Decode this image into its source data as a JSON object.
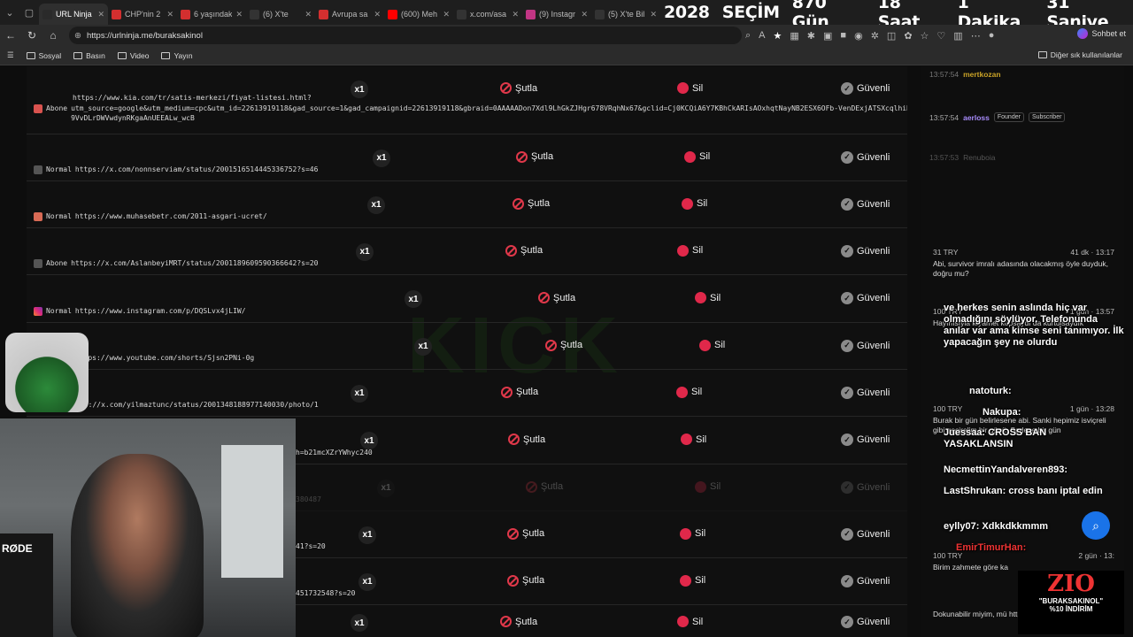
{
  "browser": {
    "tabs": [
      {
        "title": "URL Ninja |",
        "icon": "kick-icon",
        "color": "#2a2a2a",
        "active": true
      },
      {
        "title": "CHP'nin 2",
        "icon": "news-icon",
        "color": "#d32f2f"
      },
      {
        "title": "6 yaşındaki",
        "icon": "news-icon",
        "color": "#d32f2f"
      },
      {
        "title": "(6) X'te",
        "icon": "x-icon",
        "color": "#333"
      },
      {
        "title": "Avrupa sa",
        "icon": "news-icon",
        "color": "#d32f2f"
      },
      {
        "title": "(600) Meh",
        "icon": "youtube-icon",
        "color": "#ff0000"
      },
      {
        "title": "x.com/asa",
        "icon": "x-icon",
        "color": "#333"
      },
      {
        "title": "(9) Instagr",
        "icon": "instagram-icon",
        "color": "#c13584"
      },
      {
        "title": "(5) X'te Bil",
        "icon": "x-icon",
        "color": "#333"
      }
    ],
    "countdown": {
      "years": "2028",
      "label1": "SEÇİM",
      "days": "870 Gün",
      "hours": "18 Saat",
      "minutes": "1 Dakika",
      "seconds": "31 Saniye"
    },
    "url": "https://urlninja.me/buraksakinol",
    "copilot_label": "Sohbet et",
    "bookmarks": [
      "Sosyal",
      "Basın",
      "Video",
      "Yayın"
    ],
    "bookmarks_right": "Diğer sık kullanılanlar"
  },
  "actions": {
    "ban": "Şutla",
    "delete": "Sil",
    "safe": "Güvenli",
    "multiplier": "x1"
  },
  "rows": [
    {
      "type": "Abone",
      "src": "k",
      "url": "https://www.kia.com/tr/satis-merkezi/fiyat-listesi.html?",
      "url2": "utm_source=google&utm_medium=cpc&utm_id=22613919118&gad_source=1&gad_campaignid=22613919118&gbraid=0AAAAADon7Xdl9LhGkZJHgr678VRqhNx67&gclid=Cj0KCQiA6Y7KBhCkARIsAOxhqtNayNB2ESX6OFb-VenDExjATSXcqlhiRAq6Xz9VvDLrDWVwdynRKgaAnUEEALw_wcB"
    },
    {
      "type": "Normal",
      "src": "xx",
      "url": "https://x.com/nonnserviam/status/2001516514445336752?s=46"
    },
    {
      "type": "Normal",
      "src": "m",
      "url": "https://www.muhasebetr.com/2011-asgari-ucret/"
    },
    {
      "type": "Abone",
      "src": "xx",
      "url": "https://x.com/AslanbeyiMRT/status/2001189609590366642?s=20"
    },
    {
      "type": "Normal",
      "src": "ig",
      "url": "https://www.instagram.com/p/DQSLvx4jLIW/"
    },
    {
      "type": "Normal",
      "src": "yt",
      "url": "https://www.youtube.com/shorts/Sjsn2PNi-0g"
    },
    {
      "type": "",
      "src": "",
      "url": "ps://x.com/yilmaztunc/status/2001348188977140030/photo/1"
    },
    {
      "type": "",
      "src": "",
      "url": "h=b21mcXZrYWhyc240"
    },
    {
      "type": "",
      "src": "",
      "url": "380487"
    },
    {
      "type": "",
      "src": "",
      "url": "41?s=20"
    },
    {
      "type": "",
      "src": "",
      "url": "451732548?s=20"
    },
    {
      "type": "",
      "src": "",
      "url": ""
    }
  ],
  "chat": {
    "lines": [
      {
        "user": "mertkozan",
        "time": "13:57:54"
      },
      {
        "user": "aerloss",
        "time": "13:57:54",
        "badges": [
          "Founder",
          "Subscriber"
        ]
      },
      {
        "user": "Renuboia",
        "time": "13:57:53"
      }
    ],
    "overlay_messages": [
      "ve herkes senin aslında hiç var olmadığını söylüyor. Telefonunda anılar var ama kimse seni tanımıyor. İlk yapacağın şey ne olurdu",
      "natoturk:",
      "Nakupa:",
      "Juessaa: CROSS BAN YASAKLANSIN",
      "NecmettinYandalveren893:",
      "LastShrukan: cross banı iptal edin",
      "eylly07: Xdkkdkkmmm",
      "EmirTimurHan:"
    ],
    "donations": [
      {
        "amount": "31 TRY",
        "time": "41 dk · 13:17",
        "text": "Abi, survivor imralı adasında olacakmış öyle duyduk, doğru mu?"
      },
      {
        "amount": "100 TRY",
        "time": "1 gün · 13:57",
        "text": "Hayırlısıyla kıyamet kopsaydı da kurtulsaydık"
      },
      {
        "amount": "100 TRY",
        "time": "1 gün · 13:28",
        "text": "Burak bir gün belirlesene abi. Sanki hepimiz isviçreli gibi geçirelim bir günü. Sadece bir gün"
      },
      {
        "amount": "100 TRY",
        "time": "2 gün · 13:",
        "text": "Birim zahmete göre ka"
      },
      {
        "amount": "",
        "time": "",
        "text": "Dokunabilir miyim, mü https://www.youtube.c"
      }
    ]
  },
  "promo": {
    "logo": "ZIO",
    "line1": "\"BURAKSAKINOL\"",
    "line2": "%10 İNDİRİM"
  },
  "webcam": {
    "brand": "RØDE"
  }
}
